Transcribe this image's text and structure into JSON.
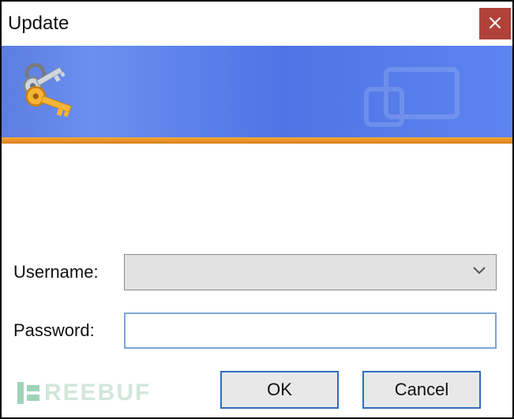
{
  "window": {
    "title": "Update",
    "close_tooltip": "Close"
  },
  "form": {
    "username_label": "Username:",
    "username_value": "",
    "password_label": "Password:",
    "password_value": ""
  },
  "buttons": {
    "ok": "OK",
    "cancel": "Cancel"
  },
  "watermark": "REEBUF",
  "icons": {
    "key": "keys-icon",
    "close": "close-icon",
    "chevron": "chevron-down-icon"
  },
  "colors": {
    "banner_start": "#5b7ee0",
    "banner_end": "#5d84f0",
    "accent_orange": "#f7a63a",
    "close_bg": "#b0423a",
    "button_border": "#2d6cc4"
  }
}
